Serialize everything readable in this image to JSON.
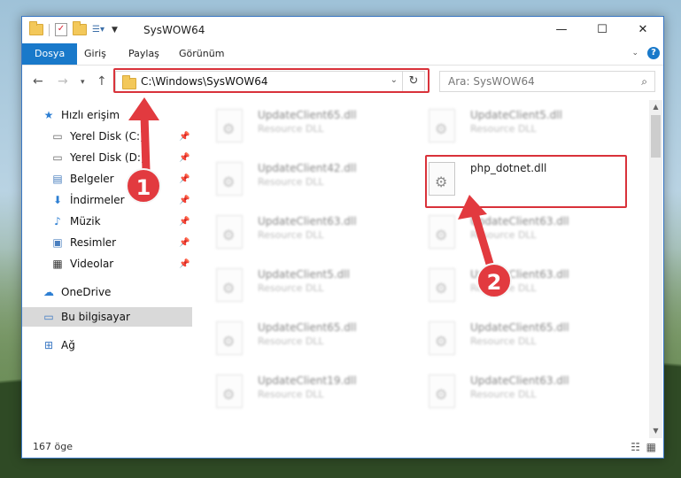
{
  "window": {
    "title": "SysWOW64"
  },
  "ribbon": {
    "tabs": [
      "Dosya",
      "Giriş",
      "Paylaş",
      "Görünüm"
    ]
  },
  "navbar": {
    "address": "C:\\Windows\\SysWOW64",
    "search_placeholder": "Ara: SysWOW64"
  },
  "sidebar": {
    "items": [
      {
        "label": "Hızlı erişim",
        "icon": "star-icon"
      },
      {
        "label": "Yerel Disk (C:)",
        "icon": "drive-icon",
        "pinned": true
      },
      {
        "label": "Yerel Disk (D:)",
        "icon": "drive-icon",
        "pinned": true
      },
      {
        "label": "Belgeler",
        "icon": "documents-icon",
        "pinned": true
      },
      {
        "label": "İndirmeler",
        "icon": "download-icon",
        "pinned": true
      },
      {
        "label": "Müzik",
        "icon": "music-icon",
        "pinned": true
      },
      {
        "label": "Resimler",
        "icon": "pictures-icon",
        "pinned": true
      },
      {
        "label": "Videolar",
        "icon": "video-icon",
        "pinned": true
      },
      {
        "label": "OneDrive",
        "icon": "cloud-icon"
      },
      {
        "label": "Bu bilgisayar",
        "icon": "computer-icon",
        "selected": true
      },
      {
        "label": "Ağ",
        "icon": "network-icon"
      }
    ]
  },
  "files": [
    {
      "name": "UpdateClient65.dll",
      "desc": "Resource DLL"
    },
    {
      "name": "UpdateClient5.dll",
      "desc": "Resource DLL"
    },
    {
      "name": "UpdateClient42.dll",
      "desc": "Resource DLL"
    },
    {
      "name": "php_dotnet.dll",
      "desc": ""
    },
    {
      "name": "UpdateClient63.dll",
      "desc": "Resource DLL"
    },
    {
      "name": "UpdateClient63.dll",
      "desc": "Resource DLL"
    },
    {
      "name": "UpdateClient5.dll",
      "desc": "Resource DLL"
    },
    {
      "name": "UpdateClient63.dll",
      "desc": "Resource DLL"
    },
    {
      "name": "UpdateClient65.dll",
      "desc": "Resource DLL"
    },
    {
      "name": "UpdateClient65.dll",
      "desc": "Resource DLL"
    },
    {
      "name": "UpdateClient19.dll",
      "desc": "Resource DLL"
    },
    {
      "name": "UpdateClient63.dll",
      "desc": "Resource DLL"
    }
  ],
  "status": {
    "item_count": "167 öge"
  },
  "annotations": {
    "badge1": "1",
    "badge2": "2"
  },
  "colors": {
    "accent": "#1979ca",
    "annotation_red": "#e23a3f"
  }
}
